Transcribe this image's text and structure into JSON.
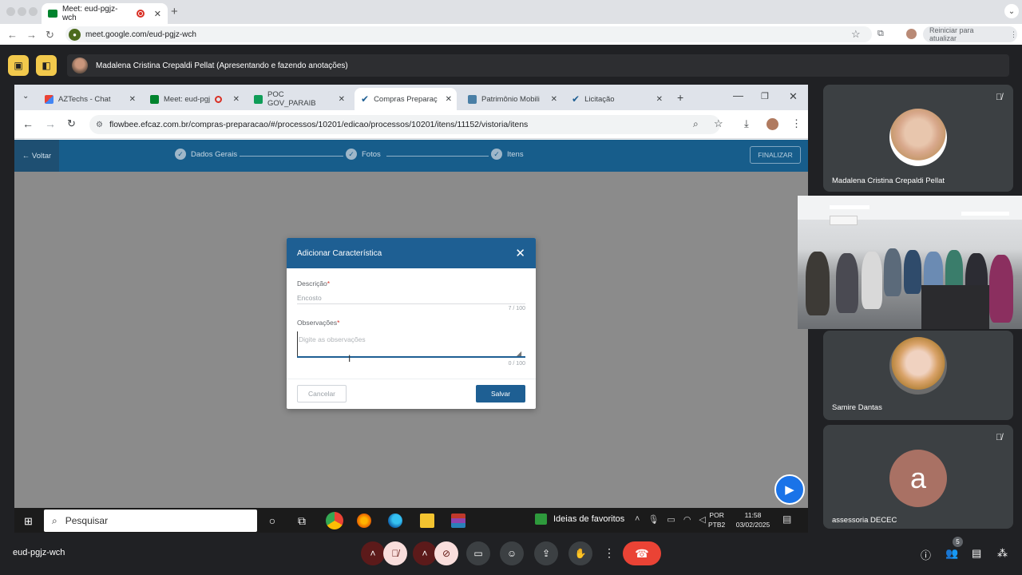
{
  "outer_browser": {
    "tab_title": "Meet: eud-pgjz-wch",
    "url": "meet.google.com/eud-pgjz-wch",
    "restart_label": "Reiniciar para atualizar"
  },
  "meet": {
    "presenter_text": "Madalena Cristina Crepaldi Pellat (Apresentando e fazendo anotações)",
    "meeting_code": "eud-pgjz-wch",
    "people_count": "5",
    "participants": [
      {
        "name": "Madalena Cristina Crepaldi Pellat"
      },
      {
        "name": "Samire Dantas"
      },
      {
        "name": "assessoria DECEC",
        "initial": "a"
      }
    ]
  },
  "inner_browser": {
    "tabs": [
      {
        "label": "AZTechs - Chat"
      },
      {
        "label": "Meet: eud-pgj"
      },
      {
        "label": "POC GOV_PARAIB"
      },
      {
        "label": "Compras Preparaç"
      },
      {
        "label": "Patrimônio Mobili"
      },
      {
        "label": "Licitação"
      }
    ],
    "url": "flowbee.efcaz.com.br/compras-preparacao/#/processos/10201/edicao/processos/10201/itens/11152/vistoria/itens"
  },
  "app": {
    "back_label": "← Voltar",
    "steps": [
      {
        "label": "Dados Gerais"
      },
      {
        "label": "Fotos"
      },
      {
        "label": "Itens"
      }
    ],
    "finalize_label": "FINALIZAR"
  },
  "dialog": {
    "title": "Adicionar Característica",
    "descricao_label": "Descrição",
    "descricao_value": "Encosto",
    "descricao_count": "7 / 100",
    "observacoes_label": "Observações",
    "observacoes_placeholder": "Digite as observações",
    "observacoes_count": "0 / 100",
    "cancel_label": "Cancelar",
    "save_label": "Salvar"
  },
  "taskbar": {
    "search_placeholder": "Pesquisar",
    "news_label": "Ideias de favoritos",
    "lang_line1": "POR",
    "lang_line2": "PTB2",
    "time": "11:58",
    "date": "03/02/2025"
  },
  "colors": {
    "accent_blue": "#1e5f93",
    "nav_blue": "#175d8b",
    "meet_bg": "#202124",
    "end_call": "#ea4335",
    "presenter_yellow": "#f2c94c"
  }
}
